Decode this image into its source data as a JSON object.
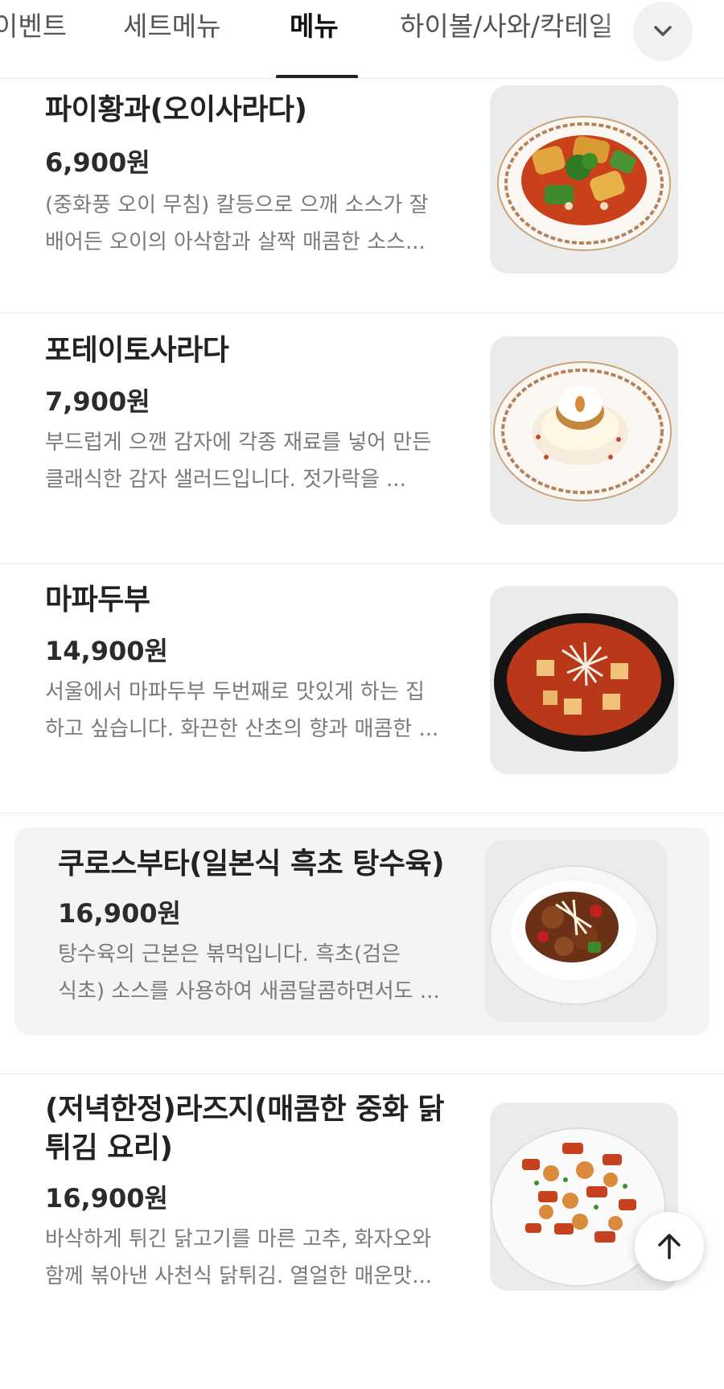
{
  "tabs": [
    {
      "label": "이벤트",
      "active": false
    },
    {
      "label": "세트메뉴",
      "active": false
    },
    {
      "label": "메뉴",
      "active": true
    },
    {
      "label": "하이볼/사와/칵테일",
      "active": false
    }
  ],
  "tab_expand_icon": "chevron-down-icon",
  "scroll_top_icon": "arrow-up-icon",
  "menu_items": [
    {
      "name": "파이황과(오이사라다)",
      "price": "6,900원",
      "desc_line1": "(중화풍 오이 무침) 칼등으로 으깨 소스가 잘",
      "desc_line2": "배어든 오이의 아삭함과 살짝 매콤한 소스...",
      "image": "cucumber-salad-dish"
    },
    {
      "name": "포테이토사라다",
      "price": "7,900원",
      "desc_line1": "부드럽게 으깬 감자에 각종 재료를 넣어 만든",
      "desc_line2": "클래식한 감자 샐러드입니다. 젓가락을 ...",
      "image": "potato-salad-dish"
    },
    {
      "name": "마파두부",
      "price": "14,900원",
      "desc_line1": "서울에서 마파두부 두번째로 맛있게 하는 집",
      "desc_line2": "하고 싶습니다. 화끈한 산초의 향과 매콤한 ...",
      "image": "mapo-tofu-dish"
    },
    {
      "name": "쿠로스부타(일본식 흑초 탕수육)",
      "price": "16,900원",
      "desc_line1": "탕수육의 근본은 볶먹입니다. 흑초(검은",
      "desc_line2": "식초) 소스를 사용하여 새콤달콤하면서도 ...",
      "image": "black-vinegar-pork-dish",
      "highlighted": true
    },
    {
      "name": "(저녁한정)라즈지(매콤한 중화 닭 튀김 요리)",
      "price": "16,900원",
      "desc_line1": "바삭하게 튀긴 닭고기를 마른 고추, 화자오와",
      "desc_line2": "함께 볶아낸 사천식 닭튀김. 열얼한 매운맛...",
      "image": "laziji-chicken-dish"
    }
  ],
  "colors": {
    "active_tab": "#111111",
    "inactive_tab": "#555555",
    "description": "#7a7a7a",
    "highlight_bg": "#f3f4f6"
  }
}
